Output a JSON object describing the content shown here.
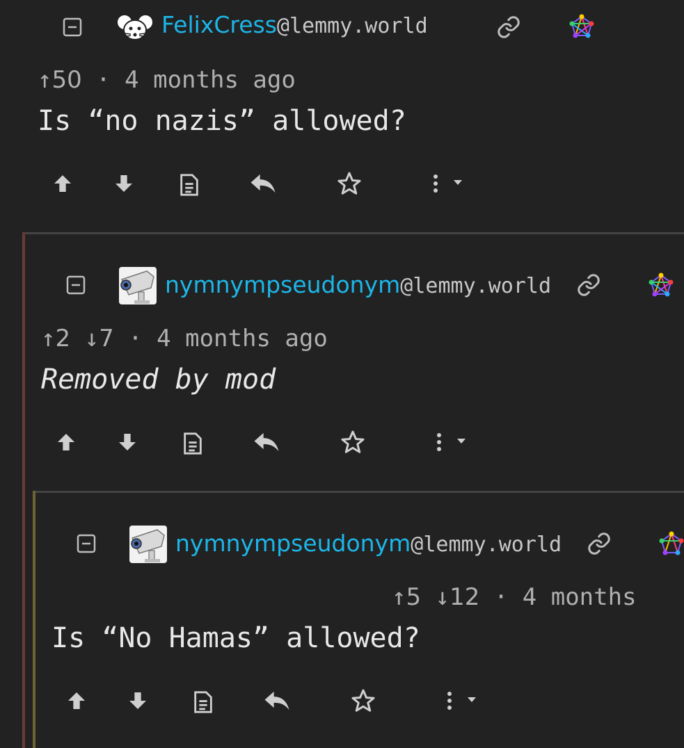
{
  "comments": [
    {
      "username": "FelixCress",
      "instance": "@lemmy.world",
      "upvotes": "50",
      "downvotes": "",
      "time": "4 months ago",
      "content": "Is “no nazis” allowed?"
    },
    {
      "username": "nymnympseudonym",
      "instance": "@lemmy.world",
      "upvotes": "2",
      "downvotes": "7",
      "time": "4 months ago",
      "content": "Removed by mod"
    },
    {
      "username": "nymnympseudonym",
      "instance": "@lemmy.world",
      "upvotes": "5",
      "downvotes": "12",
      "time": "4 months",
      "content": "Is “No Hamas” allowed?"
    }
  ],
  "colors": {
    "background": "#222222",
    "username": "#1cb6e8",
    "thread_border_1": "#6b3a3a",
    "thread_border_2": "#6b6534"
  }
}
